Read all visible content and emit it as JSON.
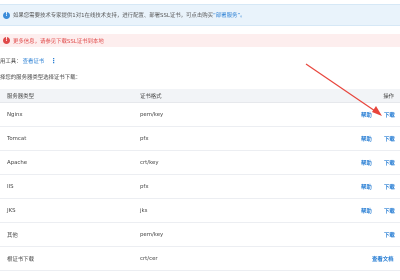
{
  "banner": {
    "text": "如果您需要技术专家提供1对1在线技术支持，进行配置、部署SSL证书，可点击购买",
    "link": "“部署服务”。"
  },
  "alert": {
    "text": "更多信息，请参见下载SSL证书到本地"
  },
  "tools": {
    "label": "用工具：",
    "link": "查看证书",
    "more": "⋮"
  },
  "hint": "择您的服务器类型选择证书下载：",
  "table": {
    "headers": {
      "server": "服务器类型",
      "format": "证书格式",
      "action": "操作"
    },
    "rows": [
      {
        "server": "Nginx",
        "format": "pem/key",
        "help": "帮助",
        "download": "下载"
      },
      {
        "server": "Tomcat",
        "format": "pfx",
        "help": "帮助",
        "download": "下载"
      },
      {
        "server": "Apache",
        "format": "crt/key",
        "help": "帮助",
        "download": "下载"
      },
      {
        "server": "IIS",
        "format": "pfx",
        "help": "帮助",
        "download": "下载"
      },
      {
        "server": "JKS",
        "format": "jks",
        "help": "帮助",
        "download": "下载"
      },
      {
        "server": "其他",
        "format": "pem/key",
        "help": "",
        "download": "下载"
      },
      {
        "server": "根证书下载",
        "format": "crt/cer",
        "docs": "查看文档"
      }
    ]
  },
  "colors": {
    "link": "#2a7fd4",
    "error": "#e04848",
    "arrow": "#e8453c"
  }
}
